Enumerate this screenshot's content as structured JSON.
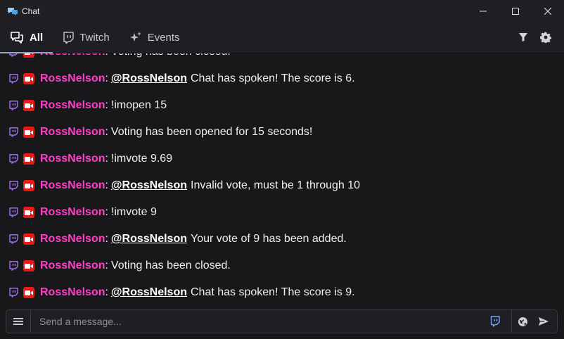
{
  "window": {
    "title": "Chat"
  },
  "tabs": [
    {
      "label": "All",
      "icon": "chat-bubbles-icon",
      "active": true
    },
    {
      "label": "Twitch",
      "icon": "twitch-icon",
      "active": false
    },
    {
      "label": "Events",
      "icon": "sparkles-icon",
      "active": false
    }
  ],
  "messages": [
    {
      "user": "RossNelson",
      "mention": "",
      "text": "Voting has been closed."
    },
    {
      "user": "RossNelson",
      "mention": "@RossNelson",
      "text": "Chat has spoken! The score is 6."
    },
    {
      "user": "RossNelson",
      "mention": "",
      "text": "!imopen 15"
    },
    {
      "user": "RossNelson",
      "mention": "",
      "text": "Voting has been opened for 15 seconds!"
    },
    {
      "user": "RossNelson",
      "mention": "",
      "text": "!imvote 9.69"
    },
    {
      "user": "RossNelson",
      "mention": "@RossNelson",
      "text": "Invalid vote, must be 1 through 10"
    },
    {
      "user": "RossNelson",
      "mention": "",
      "text": "!imvote 9"
    },
    {
      "user": "RossNelson",
      "mention": "@RossNelson",
      "text": "Your vote of 9 has been added."
    },
    {
      "user": "RossNelson",
      "mention": "",
      "text": "Voting has been closed."
    },
    {
      "user": "RossNelson",
      "mention": "@RossNelson",
      "text": "Chat has spoken! The score is 9."
    }
  ],
  "composer": {
    "placeholder": "Send a message..."
  },
  "colors": {
    "username": "#ff3ec9",
    "twitch": "#a970ff",
    "camera_badge": "#e91916",
    "active_tab_underline": "#8ea3c8"
  }
}
